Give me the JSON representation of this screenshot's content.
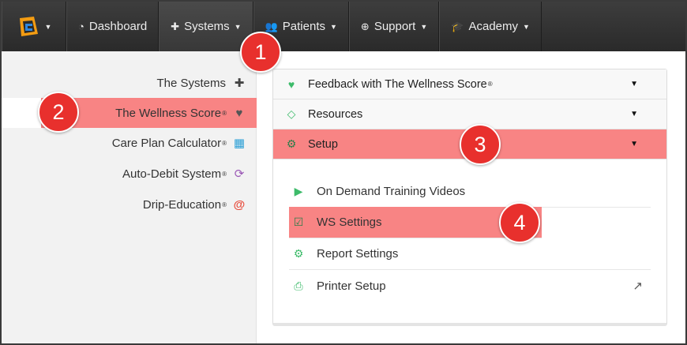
{
  "nav": {
    "logo_icon": "brand-logo-icon",
    "items": [
      {
        "label": "Dashboard",
        "icon": "dashboard-icon",
        "glyph": "◔",
        "caret": ""
      },
      {
        "label": "Systems",
        "icon": "puzzle-icon",
        "glyph": "✚",
        "caret": "▼"
      },
      {
        "label": "Patients",
        "icon": "users-icon",
        "glyph": "👥",
        "caret": "▼"
      },
      {
        "label": "Support",
        "icon": "lifebuoy-icon",
        "glyph": "⊕",
        "caret": "▼"
      },
      {
        "label": "Academy",
        "icon": "graduation-cap-icon",
        "glyph": "🎓",
        "caret": "▼"
      }
    ]
  },
  "sidebar": {
    "items": [
      {
        "label": "The Systems",
        "reg": "",
        "glyph": "✚",
        "icon": "puzzle-icon",
        "color": "#444444"
      },
      {
        "label": "The Wellness Score",
        "reg": "®",
        "glyph": "♥",
        "icon": "heart-pulse-icon",
        "color": "#555555"
      },
      {
        "label": "Care Plan Calculator",
        "reg": "®",
        "glyph": "▦",
        "icon": "calculator-icon",
        "color": "#2a9fd6"
      },
      {
        "label": "Auto-Debit System",
        "reg": "®",
        "glyph": "⟳",
        "icon": "refresh-icon",
        "color": "#9b59b6"
      },
      {
        "label": "Drip-Education",
        "reg": "®",
        "glyph": "@",
        "icon": "at-sign-icon",
        "color": "#e74c3c"
      }
    ]
  },
  "panel": {
    "sections": [
      {
        "label": "Feedback with The Wellness Score",
        "reg": "®",
        "glyph": "♥",
        "icon": "heartbeat-icon",
        "caret": "▼"
      },
      {
        "label": "Resources",
        "reg": "",
        "glyph": "◇",
        "icon": "diamond-icon",
        "caret": "▼"
      },
      {
        "label": "Setup",
        "reg": "",
        "glyph": "⚙",
        "icon": "cogs-icon",
        "caret": "▼"
      }
    ],
    "setup_items": [
      {
        "label": "On Demand Training Videos",
        "glyph": "▶",
        "icon": "video-camera-icon"
      },
      {
        "label": "WS Settings",
        "glyph": "☑",
        "icon": "checkbox-icon"
      },
      {
        "label": "Report Settings",
        "glyph": "⚙",
        "icon": "gear-icon"
      },
      {
        "label": "Printer Setup",
        "glyph": "⎙",
        "icon": "printer-icon"
      }
    ],
    "external_glyph": "↗"
  },
  "badges": [
    "1",
    "2",
    "3",
    "4"
  ],
  "colors": {
    "highlight": "#f88484",
    "badge": "#e8302d",
    "accent_green": "#3dbb6a",
    "nav_bg": "#333333"
  }
}
